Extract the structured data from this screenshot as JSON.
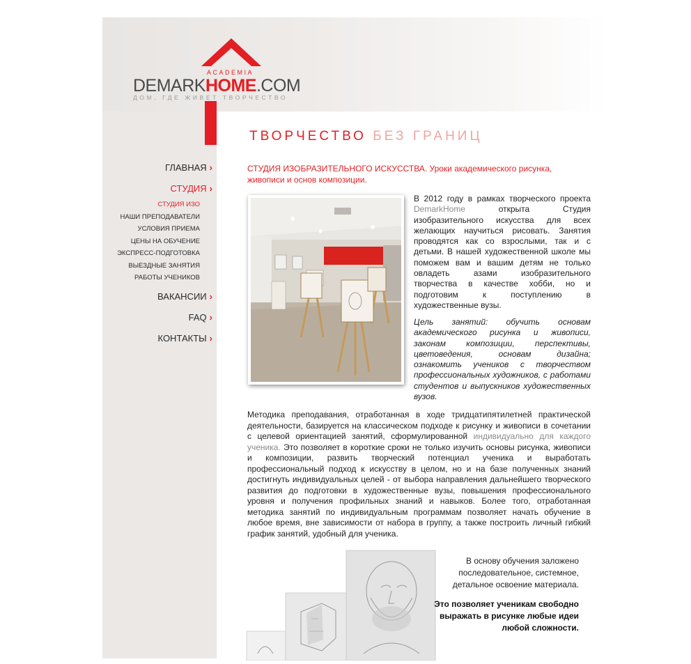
{
  "logo": {
    "brand_left": "DEMARK",
    "brand_right": "HOME",
    "brand_suffix": ".COM",
    "academia": "ACADEMIA",
    "tagline": "ДОМ, ГДЕ ЖИВЕТ ТВОРЧЕСТВО"
  },
  "nav": {
    "main": [
      {
        "label": "ГЛАВНАЯ"
      },
      {
        "label": "СТУДИЯ"
      },
      {
        "label": "ВАКАНСИИ"
      },
      {
        "label": "FAQ"
      },
      {
        "label": "КОНТАКТЫ"
      }
    ],
    "sub": [
      {
        "label": "СТУДИЯ ИЗО"
      },
      {
        "label": "НАШИ ПРЕПОДАВАТЕЛИ"
      },
      {
        "label": "УСЛОВИЯ ПРИЕМА"
      },
      {
        "label": "ЦЕНЫ НА ОБУЧЕНИЕ"
      },
      {
        "label": "ЭКСПРЕСС-ПОДГОТОВКА"
      },
      {
        "label": "ВЫЕЗДНЫЕ ЗАНЯТИЯ"
      },
      {
        "label": "РАБОТЫ УЧЕНИКОВ"
      }
    ],
    "chevron": "›"
  },
  "slogan": {
    "part1": "ТВОРЧЕСТВО",
    "part2": "БЕЗ ГРАНИЦ"
  },
  "intro": "СТУДИЯ ИЗОБРАЗИТЕЛЬНОГО ИСКУССТВА. Уроки академического рисунка, живописи и основ композиции.",
  "about": {
    "before_link": "В 2012 году в рамках творческого проекта ",
    "link": "DemarkHome",
    "after_link": " открыта Студия изобразительного искусства для всех желающих научиться рисовать. Занятия проводятся как со взрослыми, так и с детьми. В нашей художественной школе мы поможем вам и вашим детям не только овладеть азами изобразительного творчества в качестве хобби, но и подготовим к поступлению в художественные вузы."
  },
  "goal": "Цель занятий: обучить основам академического рисунка и живописи, законам композиции, перспективы, цветоведения, основам дизайна; ознакомить учеников с творчеством профессиональных художников, с работами студентов и выпускников художественных вузов.",
  "method": {
    "before": "Методика преподавания, отработанная в ходе тридцатипятилетней практической деятельности, базируется на классическом подходе к рисунку и живописи в сочетании с целевой ориентацией занятий, сформулированной ",
    "highlight": "индивидуально для каждого ученика.",
    "after": " Это позволяет в короткие сроки не только изучить основы рисунка, живописи и композиции, развить творческий потенциал ученика и выработать профессиональный подход к искусству в целом, но и на базе полученных знаний достигнуть индивидуальных целей - от выбора направления дальнейшего творческого развития до подготовки в художественные вузы, повышения профессионального уровня и получения профильных знаний и навыков. Более того, отработанная методика занятий по индивидуальным программам позволяет начать обучение в любое время, вне зависимости от набора в группу, а также построить личный гибкий график занятий, удобный для ученика."
  },
  "basis": "В основу обучения заложено последовательное, системное, детальное освоение материала.",
  "benefit": "Это позволяет ученикам свободно выражать в рисунке любые идеи любой сложности.",
  "colors": {
    "accent": "#e31e24",
    "sidebar": "#ebe8e6",
    "text": "#222222",
    "muted": "#8a8a8a"
  }
}
